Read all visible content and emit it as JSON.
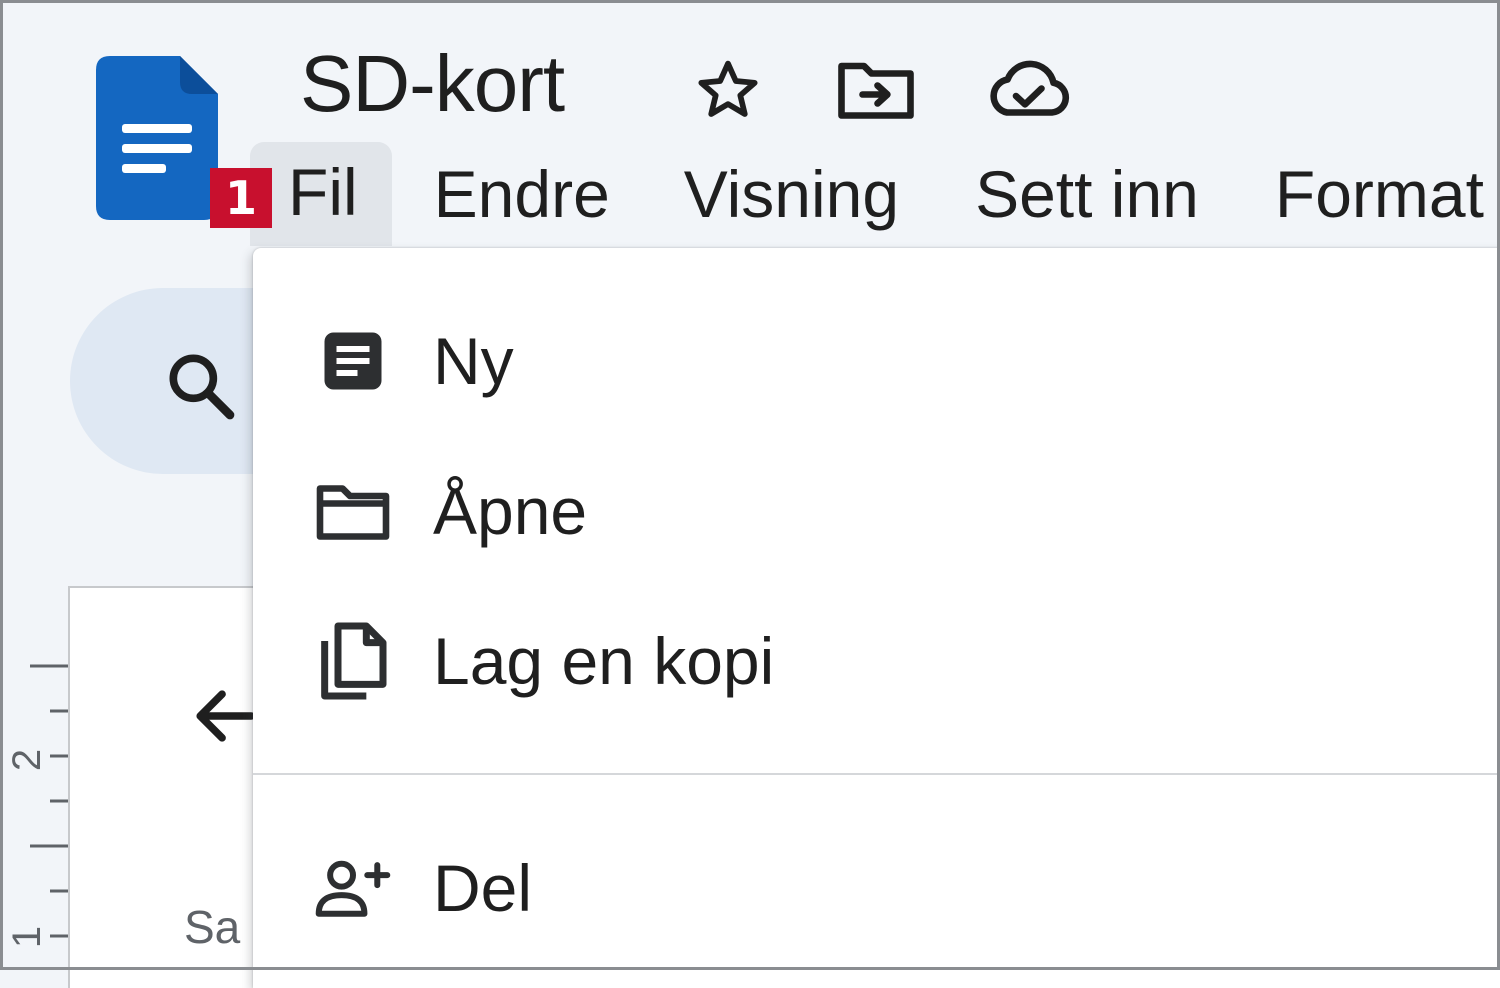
{
  "document": {
    "title": "SD-kort"
  },
  "title_icons": [
    "star-icon",
    "move-to-folder-icon",
    "cloud-saved-icon"
  ],
  "menubar": {
    "items": [
      {
        "label": "Fil",
        "active": true
      },
      {
        "label": "Endre"
      },
      {
        "label": "Visning"
      },
      {
        "label": "Sett inn"
      },
      {
        "label": "Format"
      }
    ]
  },
  "step_badge": "1",
  "file_menu": {
    "items": [
      {
        "label": "Ny",
        "icon": "document-icon"
      },
      {
        "label": "Åpne",
        "icon": "folder-icon"
      },
      {
        "label": "Lag en kopi",
        "icon": "copy-icon"
      },
      {
        "label": "Del",
        "icon": "add-person-icon"
      }
    ]
  },
  "ruler": {
    "label_2": "2",
    "label_1": "1"
  },
  "outline": {
    "label": "Sa"
  },
  "colors": {
    "docs_blue": "#0b66c2",
    "badge_red": "#c8102e",
    "active_menu_bg": "#e1e5ea",
    "search_bg": "#dfe8f3"
  }
}
